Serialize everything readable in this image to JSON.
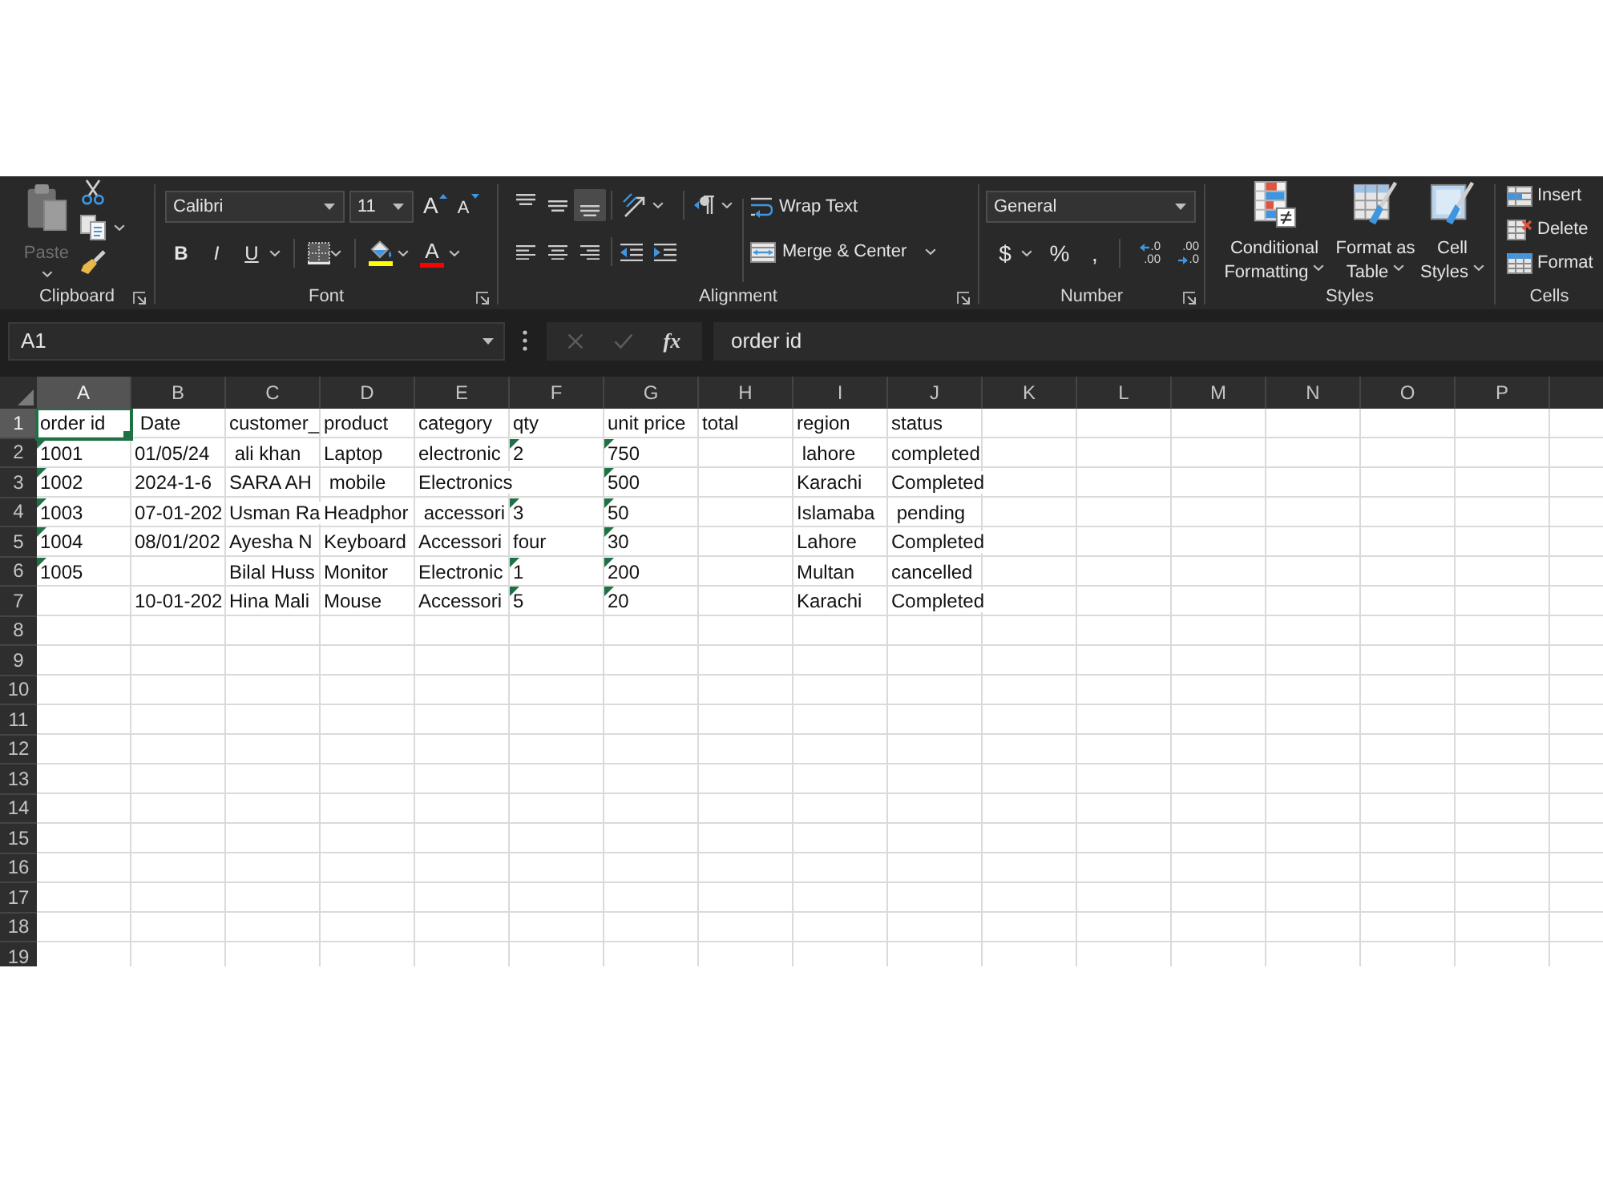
{
  "ribbon": {
    "clipboard": {
      "label": "Clipboard",
      "dialog_launcher": true,
      "paste": {
        "label": "Paste",
        "disabled": true
      },
      "tools": [
        {
          "kind": "cut",
          "disabled": false
        },
        {
          "kind": "copy",
          "disabled": false
        },
        {
          "kind": "format_painter",
          "disabled": false
        }
      ]
    },
    "font": {
      "label": "Font",
      "dialog_launcher": true,
      "name": "Calibri",
      "size": "11",
      "size_buttons": [
        {
          "kind": "grow",
          "glyph": "A"
        },
        {
          "kind": "shrink",
          "glyph": "A"
        }
      ],
      "style_buttons": [
        {
          "kind": "bold",
          "glyph": "B"
        },
        {
          "kind": "italic",
          "glyph": "I"
        },
        {
          "kind": "underline",
          "glyph": "U"
        }
      ],
      "color_buttons": [
        {
          "kind": "fill",
          "color": "#ffff00"
        },
        {
          "kind": "text",
          "glyph": "A",
          "color": "#ff0000"
        }
      ]
    },
    "alignment": {
      "label": "Alignment",
      "dialog_launcher": true,
      "vertical": [
        {
          "kind": "top",
          "selected": false
        },
        {
          "kind": "middle",
          "selected": false
        },
        {
          "kind": "bottom",
          "selected": true
        }
      ],
      "horizontal": [
        {
          "kind": "left",
          "selected": false
        },
        {
          "kind": "center",
          "selected": false
        },
        {
          "kind": "right",
          "selected": false
        }
      ],
      "wrap_text": "Wrap Text",
      "merge": "Merge & Center"
    },
    "number": {
      "label": "Number",
      "dialog_launcher": true,
      "format": "General",
      "symbols": [
        {
          "kind": "currency",
          "glyph": "$"
        },
        {
          "kind": "percent",
          "glyph": "%"
        },
        {
          "kind": "comma",
          "glyph": ","
        }
      ],
      "decimals": [
        {
          "kind": "increase",
          "upper": ".0",
          "lower": ".00"
        },
        {
          "kind": "decrease",
          "upper": ".00",
          "lower": ".0"
        }
      ]
    },
    "styles": {
      "label": "Styles",
      "buttons": [
        {
          "kind": "conditional",
          "lines": [
            "Conditional",
            "Formatting"
          ]
        },
        {
          "kind": "table",
          "lines": [
            "Format as",
            "Table"
          ]
        },
        {
          "kind": "cell",
          "lines": [
            "Cell",
            "Styles"
          ]
        }
      ]
    },
    "cells": {
      "label": "Cells",
      "buttons": [
        {
          "kind": "insert",
          "label": "Insert"
        },
        {
          "kind": "delete",
          "label": "Delete"
        },
        {
          "kind": "format",
          "label": "Format"
        }
      ]
    }
  },
  "formula_bar": {
    "name_box": "A1",
    "buttons": [
      {
        "kind": "cancel",
        "disabled": true
      },
      {
        "kind": "enter",
        "disabled": true
      },
      {
        "kind": "function",
        "glyph": "fx",
        "disabled": false
      }
    ],
    "formula": "order id"
  },
  "sheet": {
    "columns": [
      {
        "label": "A",
        "selected": true
      },
      {
        "label": "B",
        "selected": false
      },
      {
        "label": "C",
        "selected": false
      },
      {
        "label": "D",
        "selected": false
      },
      {
        "label": "E",
        "selected": false
      },
      {
        "label": "F",
        "selected": false
      },
      {
        "label": "G",
        "selected": false
      },
      {
        "label": "H",
        "selected": false
      },
      {
        "label": "I",
        "selected": false
      },
      {
        "label": "J",
        "selected": false
      },
      {
        "label": "K",
        "selected": false
      },
      {
        "label": "L",
        "selected": false
      },
      {
        "label": "M",
        "selected": false
      },
      {
        "label": "N",
        "selected": false
      },
      {
        "label": "O",
        "selected": false
      },
      {
        "label": "P",
        "selected": false
      }
    ],
    "rows": [
      {
        "label": "1",
        "selected": true,
        "cells": [
          {
            "text": "order id",
            "flagged": false
          },
          {
            "text": " Date",
            "flagged": false
          },
          {
            "text": "customer_",
            "flagged": false
          },
          {
            "text": "product",
            "flagged": false
          },
          {
            "text": "category",
            "flagged": false
          },
          {
            "text": "qty",
            "flagged": false
          },
          {
            "text": "unit price",
            "flagged": false
          },
          {
            "text": "total",
            "flagged": false
          },
          {
            "text": "region",
            "flagged": false
          },
          {
            "text": "status",
            "flagged": false
          }
        ]
      },
      {
        "label": "2",
        "selected": false,
        "cells": [
          {
            "text": "1001",
            "flagged": true
          },
          {
            "text": "01/05/24",
            "flagged": false
          },
          {
            "text": " ali khan",
            "flagged": false
          },
          {
            "text": "Laptop",
            "flagged": false
          },
          {
            "text": "electronic",
            "flagged": false
          },
          {
            "text": "2",
            "flagged": true
          },
          {
            "text": "750",
            "flagged": true
          },
          null,
          {
            "text": " lahore",
            "flagged": false
          },
          {
            "text": "completed",
            "flagged": false
          }
        ]
      },
      {
        "label": "3",
        "selected": false,
        "cells": [
          {
            "text": "1002",
            "flagged": true
          },
          {
            "text": "2024-1-6",
            "flagged": false
          },
          {
            "text": "SARA AH",
            "flagged": false
          },
          {
            "text": " mobile",
            "flagged": false
          },
          {
            "text": "Electronics",
            "flagged": false
          },
          null,
          {
            "text": "500",
            "flagged": true
          },
          null,
          {
            "text": "Karachi",
            "flagged": false
          },
          {
            "text": "Completed",
            "flagged": false
          }
        ]
      },
      {
        "label": "4",
        "selected": false,
        "cells": [
          {
            "text": "1003",
            "flagged": true
          },
          {
            "text": "07-01-202",
            "flagged": false
          },
          {
            "text": "Usman Ra",
            "flagged": false
          },
          {
            "text": "Headphor",
            "flagged": false
          },
          {
            "text": " accessori",
            "flagged": false
          },
          {
            "text": "3",
            "flagged": true
          },
          {
            "text": "50",
            "flagged": true
          },
          null,
          {
            "text": "Islamaba",
            "flagged": false
          },
          {
            "text": " pending",
            "flagged": false
          }
        ]
      },
      {
        "label": "5",
        "selected": false,
        "cells": [
          {
            "text": "1004",
            "flagged": true
          },
          {
            "text": "08/01/202",
            "flagged": false
          },
          {
            "text": "Ayesha N",
            "flagged": false
          },
          {
            "text": "Keyboard",
            "flagged": false
          },
          {
            "text": "Accessori",
            "flagged": false
          },
          {
            "text": "four",
            "flagged": false
          },
          {
            "text": "30",
            "flagged": true
          },
          null,
          {
            "text": "Lahore",
            "flagged": false
          },
          {
            "text": "Completed",
            "flagged": false
          }
        ]
      },
      {
        "label": "6",
        "selected": false,
        "cells": [
          {
            "text": "1005",
            "flagged": true
          },
          null,
          {
            "text": "Bilal Huss",
            "flagged": false
          },
          {
            "text": "Monitor",
            "flagged": false
          },
          {
            "text": "Electronic",
            "flagged": false
          },
          {
            "text": "1",
            "flagged": true
          },
          {
            "text": "200",
            "flagged": true
          },
          null,
          {
            "text": "Multan",
            "flagged": false
          },
          {
            "text": "cancelled",
            "flagged": false
          }
        ]
      },
      {
        "label": "7",
        "selected": false,
        "cells": [
          null,
          {
            "text": "10-01-202",
            "flagged": false
          },
          {
            "text": "Hina Mali",
            "flagged": false
          },
          {
            "text": "Mouse",
            "flagged": false
          },
          {
            "text": "Accessori",
            "flagged": false
          },
          {
            "text": "5",
            "flagged": true
          },
          {
            "text": "20",
            "flagged": true
          },
          null,
          {
            "text": "Karachi",
            "flagged": false
          },
          {
            "text": "Completed",
            "flagged": false
          }
        ]
      },
      {
        "label": "8",
        "selected": false
      },
      {
        "label": "9",
        "selected": false
      },
      {
        "label": "10",
        "selected": false
      },
      {
        "label": "11",
        "selected": false
      },
      {
        "label": "12",
        "selected": false
      },
      {
        "label": "13",
        "selected": false
      },
      {
        "label": "14",
        "selected": false
      },
      {
        "label": "15",
        "selected": false
      },
      {
        "label": "16",
        "selected": false
      },
      {
        "label": "17",
        "selected": false
      },
      {
        "label": "18",
        "selected": false
      },
      {
        "label": "19",
        "selected": false
      }
    ]
  }
}
